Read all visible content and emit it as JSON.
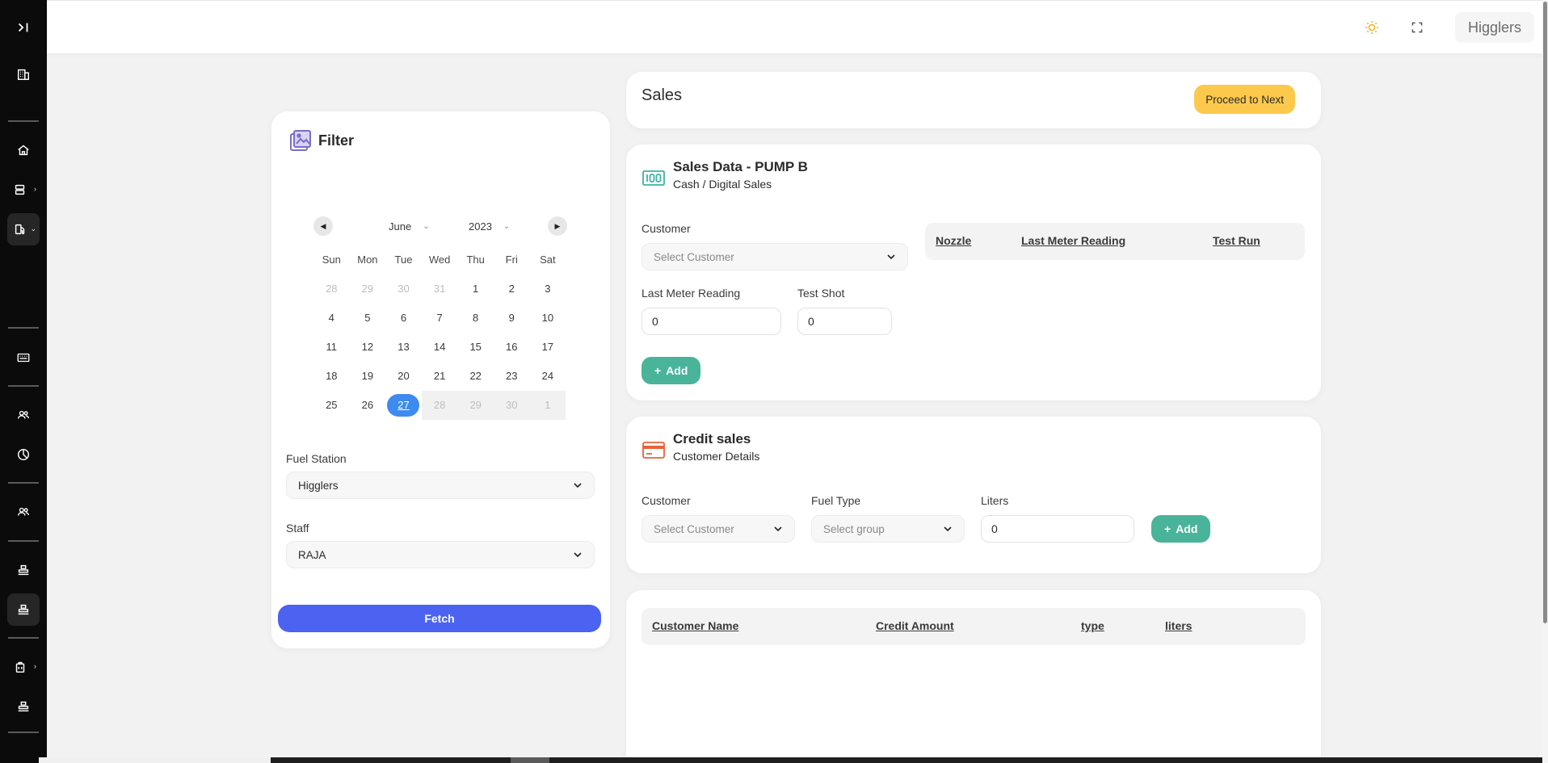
{
  "header": {
    "user": "Higglers"
  },
  "sales": {
    "title": "Sales",
    "proceed_label": "Proceed to Next"
  },
  "filter": {
    "title": "Filter",
    "calendar": {
      "month": "June",
      "year": "2023",
      "weekdays": [
        "Sun",
        "Mon",
        "Tue",
        "Wed",
        "Thu",
        "Fri",
        "Sat"
      ],
      "weeks": [
        [
          "28",
          "29",
          "30",
          "31",
          "1",
          "2",
          "3"
        ],
        [
          "4",
          "5",
          "6",
          "7",
          "8",
          "9",
          "10"
        ],
        [
          "11",
          "12",
          "13",
          "14",
          "15",
          "16",
          "17"
        ],
        [
          "18",
          "19",
          "20",
          "21",
          "22",
          "23",
          "24"
        ],
        [
          "25",
          "26",
          "27",
          "28",
          "29",
          "30",
          "1"
        ]
      ],
      "selected_day": "27"
    },
    "fuel_station_label": "Fuel Station",
    "fuel_station_value": "Higglers",
    "staff_label": "Staff",
    "staff_value": "RAJA",
    "fetch_label": "Fetch"
  },
  "pump": {
    "title": "Sales Data - PUMP B",
    "subtitle": "Cash / Digital Sales",
    "customer_label": "Customer",
    "customer_placeholder": "Select Customer",
    "last_meter_label": "Last Meter Reading",
    "last_meter_value": "0",
    "test_shot_label": "Test Shot",
    "test_shot_value": "0",
    "add_label": "Add",
    "table_headers": [
      "Nozzle",
      "Last Meter Reading",
      "Test Run"
    ]
  },
  "credit": {
    "title": "Credit sales",
    "subtitle": "Customer Details",
    "customer_label": "Customer",
    "customer_placeholder": "Select Customer",
    "fuel_type_label": "Fuel Type",
    "fuel_type_placeholder": "Select group",
    "liters_label": "Liters",
    "liters_value": "0",
    "add_label": "Add"
  },
  "credit_table": {
    "headers": [
      "Customer Name",
      "Credit Amount",
      "type",
      "liters"
    ]
  },
  "colors": {
    "accent_blue": "#4b63f0",
    "accent_green": "#49b49a",
    "accent_yellow": "#fdc94c",
    "calendar_today": "#3d8bf0"
  }
}
